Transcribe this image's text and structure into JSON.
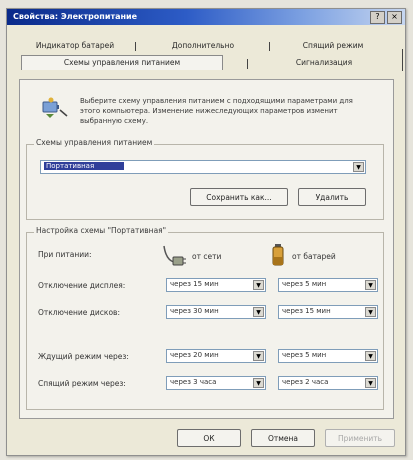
{
  "window": {
    "title": "Свойства: Электропитание",
    "help_glyph": "?",
    "close_glyph": "×"
  },
  "tabs": {
    "row1": [
      "Индикатор батарей",
      "Дополнительно",
      "Спящий режим"
    ],
    "row2": [
      "Схемы управления питанием",
      "Сигнализация"
    ],
    "active": "Схемы управления питанием"
  },
  "description": "Выберите схему управления питанием с подходящими параметрами для этого компьютера. Изменение нижеследующих параметров изменит выбранную схему.",
  "schemes": {
    "group_label": "Схемы управления питанием",
    "selected": "Портативная",
    "save_as_label": "Сохранить как...",
    "delete_label": "Удалить"
  },
  "settings": {
    "group_label": "Настройка схемы \"Портативная\"",
    "when_label": "При питании:",
    "ac_label": "от сети",
    "battery_label": "от батарей",
    "rows": [
      {
        "label": "Отключение дисплея:",
        "ac": "через 15 мин",
        "battery": "через 5 мин"
      },
      {
        "label": "Отключение дисков:",
        "ac": "через 30 мин",
        "battery": "через 15 мин"
      },
      {
        "label": "Ждущий режим через:",
        "ac": "через 20 мин",
        "battery": "через 5 мин"
      },
      {
        "label": "Спящий режим через:",
        "ac": "через 3 часа",
        "battery": "через 2 часа"
      }
    ]
  },
  "footer": {
    "ok_label": "ОК",
    "cancel_label": "Отмена",
    "apply_label": "Применить"
  },
  "colors": {
    "titlebar_start": "#0a2a8a",
    "selection": "#2f3f9a"
  },
  "icons": [
    "power-options-icon",
    "plug-icon",
    "battery-icon",
    "dropdown-arrow-icon"
  ]
}
